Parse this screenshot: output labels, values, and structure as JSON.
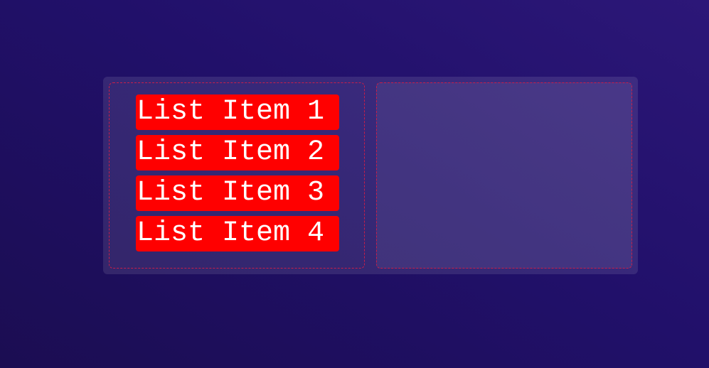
{
  "colors": {
    "item_background": "#ff0000",
    "item_text": "#ffffff",
    "dropzone_border": "#c81e4a"
  },
  "source_list": {
    "items": [
      {
        "label": "List Item 1"
      },
      {
        "label": "List Item 2"
      },
      {
        "label": "List Item 3"
      },
      {
        "label": "List Item 4"
      }
    ]
  },
  "target_list": {
    "items": []
  }
}
